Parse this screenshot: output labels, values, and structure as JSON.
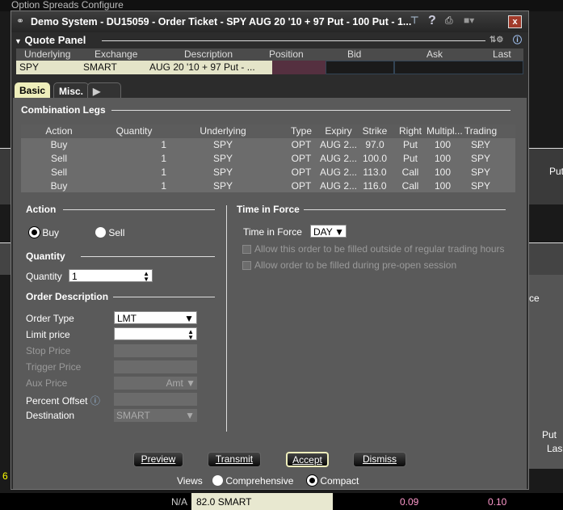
{
  "background": {
    "menu": "Option Spreads   Configure",
    "put_label": "Put",
    "last_label": "Las",
    "left_val": "6",
    "bottom": {
      "na": "N/A",
      "desc": "82.0 SMART",
      "bid": "0.09",
      "ask": "0.10"
    },
    "ce": "ce"
  },
  "window": {
    "title": "Demo System - DU15059 - Order Ticket - SPY AUG 20 '10 + 97 Put - 100 Put - 1...",
    "close": "x"
  },
  "quote_panel": {
    "title": "Quote Panel",
    "columns": [
      "Underlying",
      "Exchange",
      "Description",
      "Position",
      "Bid",
      "Ask",
      "Last"
    ],
    "row": {
      "underlying": "SPY",
      "exchange": "SMART",
      "description": "AUG 20 '10 + 97 Put - ..."
    }
  },
  "tabs": [
    "Basic",
    "Misc."
  ],
  "legs": {
    "title": "Combination Legs",
    "columns": [
      "Action",
      "Quantity",
      "Underlying",
      "Type",
      "Expiry",
      "Strike",
      "Right",
      "Multipl...",
      "Trading ..."
    ],
    "rows": [
      [
        "Buy",
        "1",
        "SPY",
        "OPT",
        "AUG 2...",
        "97.0",
        "Put",
        "100",
        "SPY"
      ],
      [
        "Sell",
        "1",
        "SPY",
        "OPT",
        "AUG 2...",
        "100.0",
        "Put",
        "100",
        "SPY"
      ],
      [
        "Sell",
        "1",
        "SPY",
        "OPT",
        "AUG 2...",
        "113.0",
        "Call",
        "100",
        "SPY"
      ],
      [
        "Buy",
        "1",
        "SPY",
        "OPT",
        "AUG 2...",
        "116.0",
        "Call",
        "100",
        "SPY"
      ]
    ]
  },
  "action": {
    "title": "Action",
    "buy": "Buy",
    "sell": "Sell"
  },
  "quantity": {
    "title": "Quantity",
    "label": "Quantity",
    "value": "1"
  },
  "order": {
    "title": "Order Description",
    "order_type_label": "Order Type",
    "order_type": "LMT",
    "limit_label": "Limit price",
    "stop_label": "Stop Price",
    "trigger_label": "Trigger Price",
    "aux_label": "Aux Price",
    "aux_unit": "Amt",
    "offset_label": "Percent Offset",
    "dest_label": "Destination",
    "dest": "SMART"
  },
  "tif": {
    "title": "Time in Force",
    "label": "Time in Force",
    "value": "DAY",
    "opt1": "Allow this order to be filled outside of regular trading hours",
    "opt2": "Allow order to be filled during pre-open session"
  },
  "buttons": {
    "preview": "Preview",
    "transmit": "Transmit",
    "accept": "Accept",
    "dismiss": "Dismiss"
  },
  "views": {
    "label": "Views",
    "comprehensive": "Comprehensive",
    "compact": "Compact"
  }
}
